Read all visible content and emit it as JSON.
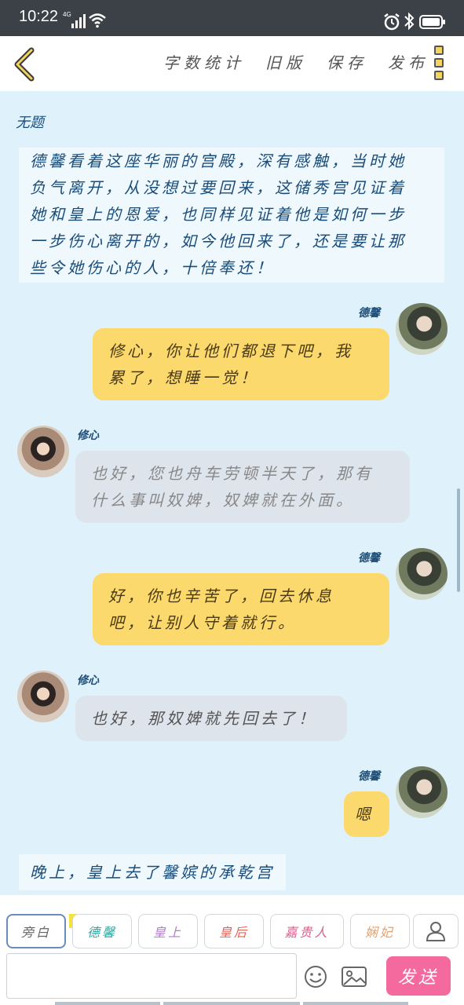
{
  "status": {
    "time": "10:22",
    "network": "4G"
  },
  "header": {
    "actions": [
      "字数统计",
      "旧版",
      "保存",
      "发布"
    ]
  },
  "chat": {
    "title": "无题",
    "narration_top": [
      "德馨看着这座华丽的宫殿，深有感触，当时她",
      "负气离开，从没想过要回来，这储秀宫见证着",
      "她和皇上的恩爱，也同样见证着他是如何一步",
      "一步伤心离开的，如今他回来了，还是要让那",
      "些令她伤心的人，十倍奉还！"
    ],
    "messages": [
      {
        "side": "right",
        "name": "德馨",
        "lines": [
          "修心，你让他们都退下吧，我",
          "累了，想睡一觉！"
        ]
      },
      {
        "side": "left",
        "name": "修心",
        "lines": [
          "也好，您也舟车劳顿半天了，那有",
          "什么事叫奴婢，奴婢就在外面。"
        ]
      },
      {
        "side": "right",
        "name": "德馨",
        "lines": [
          "好，你也辛苦了，回去休息",
          "吧，让别人守着就行。"
        ]
      },
      {
        "side": "left",
        "name": "修心",
        "lines": [
          "也好，那奴婢就先回去了！"
        ]
      },
      {
        "side": "right",
        "name": "德馨",
        "lines": [
          "嗯"
        ]
      }
    ],
    "narration_bottom": "晚上，皇上去了馨嫔的承乾宫"
  },
  "roles": {
    "items": [
      {
        "label": "旁白",
        "color": "#666666"
      },
      {
        "label": "德馨",
        "color": "#2aa7a0",
        "badge": "主"
      },
      {
        "label": "皇上",
        "color": "#b27cc9"
      },
      {
        "label": "皇后",
        "color": "#e0645a"
      },
      {
        "label": "嘉贵人",
        "color": "#e05a8f"
      },
      {
        "label": "娴妃",
        "color": "#e8a16b"
      }
    ]
  },
  "composer": {
    "placeholder": "",
    "send_label": "发送"
  }
}
